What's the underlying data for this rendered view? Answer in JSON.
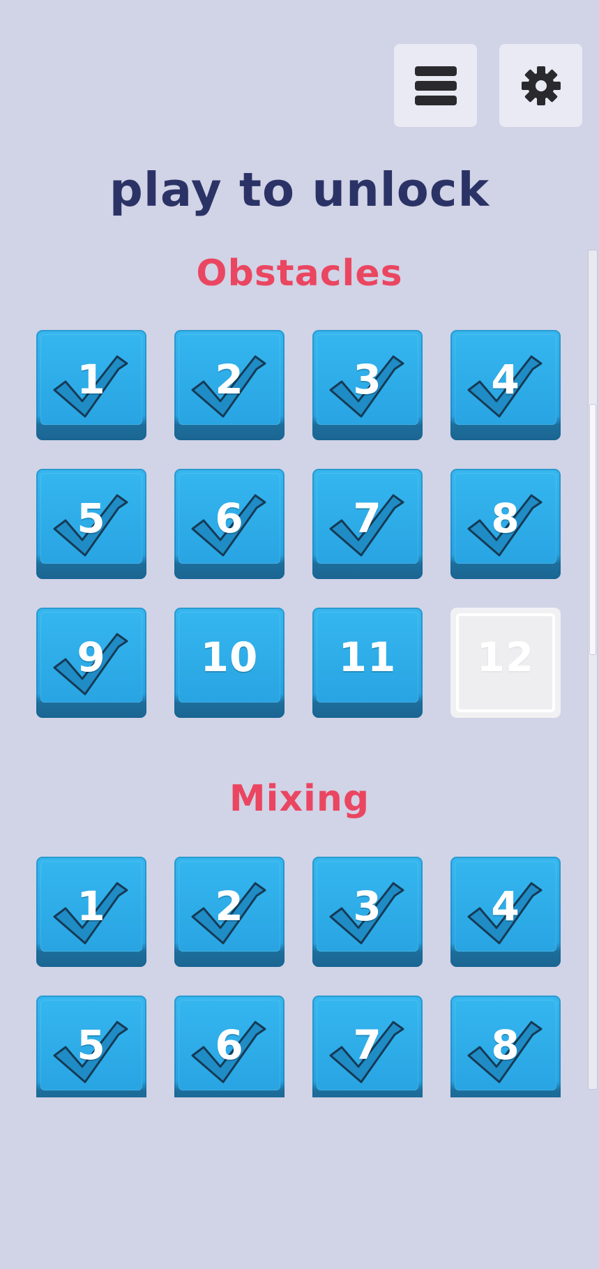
{
  "header": {
    "menu_icon": "hamburger-menu-icon",
    "settings_icon": "gear-icon"
  },
  "title": "play to unlock",
  "colors": {
    "background": "#d1d3e6",
    "title": "#2b3366",
    "section_title": "#ea4661",
    "tile": "#2aa8e6",
    "tile_locked": "#f1f1f3",
    "check": "#1f8cc5"
  },
  "sections": [
    {
      "title": "Obstacles",
      "levels": [
        {
          "label": "1",
          "completed": true,
          "locked": false
        },
        {
          "label": "2",
          "completed": true,
          "locked": false
        },
        {
          "label": "3",
          "completed": true,
          "locked": false
        },
        {
          "label": "4",
          "completed": true,
          "locked": false
        },
        {
          "label": "5",
          "completed": true,
          "locked": false
        },
        {
          "label": "6",
          "completed": true,
          "locked": false
        },
        {
          "label": "7",
          "completed": true,
          "locked": false
        },
        {
          "label": "8",
          "completed": true,
          "locked": false
        },
        {
          "label": "9",
          "completed": true,
          "locked": false
        },
        {
          "label": "10",
          "completed": false,
          "locked": false
        },
        {
          "label": "11",
          "completed": false,
          "locked": false
        },
        {
          "label": "12",
          "completed": false,
          "locked": true
        }
      ]
    },
    {
      "title": "Mixing",
      "levels": [
        {
          "label": "1",
          "completed": true,
          "locked": false
        },
        {
          "label": "2",
          "completed": true,
          "locked": false
        },
        {
          "label": "3",
          "completed": true,
          "locked": false
        },
        {
          "label": "4",
          "completed": true,
          "locked": false
        },
        {
          "label": "5",
          "completed": true,
          "locked": false
        },
        {
          "label": "6",
          "completed": true,
          "locked": false
        },
        {
          "label": "7",
          "completed": true,
          "locked": false
        },
        {
          "label": "8",
          "completed": true,
          "locked": false
        }
      ]
    }
  ]
}
